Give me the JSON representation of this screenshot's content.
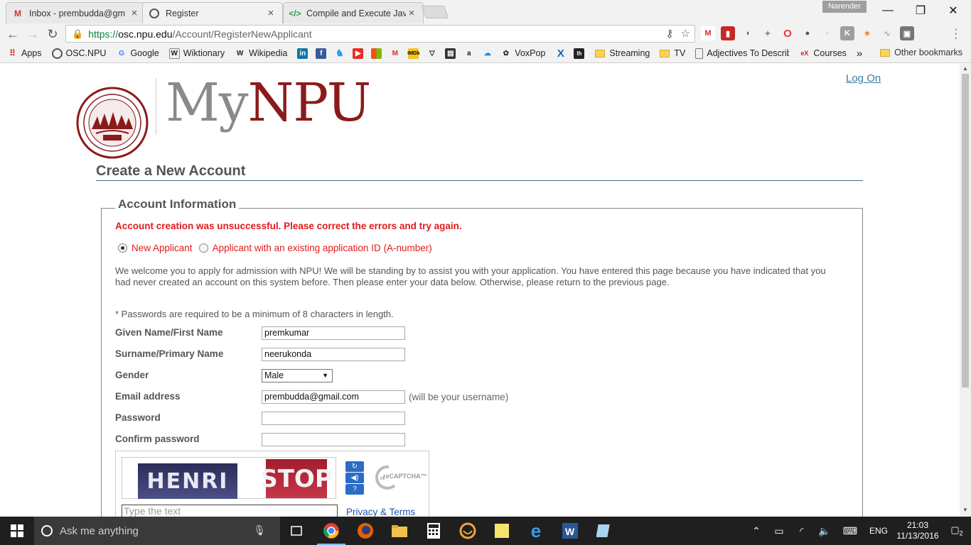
{
  "browser": {
    "tabs": [
      {
        "title": "Inbox - prembudda@gm",
        "icon": "gmail-icon"
      },
      {
        "title": "Register",
        "icon": "npu-icon"
      },
      {
        "title": "Compile and Execute Jav",
        "icon": "code-icon"
      }
    ],
    "profile_name": "Narender",
    "url": {
      "scheme": "https://",
      "host": "osc.npu.edu",
      "path": "/Account/RegisterNewApplicant"
    },
    "bookmarks": [
      "Apps",
      "OSC.NPU",
      "Google",
      "Wiktionary",
      "Wikipedia",
      "VoxPop",
      "Streaming",
      "TV",
      "Adjectives To Describe",
      "Courses"
    ],
    "bookmarks_overflow": "»",
    "other_bookmarks": "Other bookmarks"
  },
  "page": {
    "logo": {
      "my": "My",
      "npu": "NPU"
    },
    "login_link": "Log On",
    "title": "Create a New Account",
    "section_legend": "Account Information",
    "error_message": "Account creation was unsuccessful. Please correct the errors and try again.",
    "radio_new": "New Applicant",
    "radio_existing": "Applicant with an existing application ID (A-number)",
    "welcome_text": "We welcome you to apply for admission with NPU! We will be standing by to assist you with your application. You have entered this page because you have indicated that you had never created an account on this system before. Then please enter your data below. Otherwise, please return to the previous page.",
    "password_note": "* Passwords are required to be a minimum of 8 characters in length.",
    "fields": {
      "first_name_label": "Given Name/First Name",
      "first_name_value": "premkumar",
      "surname_label": "Surname/Primary Name",
      "surname_value": "neerukonda",
      "gender_label": "Gender",
      "gender_value": "Male",
      "email_label": "Email address",
      "email_value": "prembudda@gmail.com",
      "email_hint": "(will be your username)",
      "password_label": "Password",
      "confirm_label": "Confirm password"
    },
    "captcha": {
      "word1": "HENRI",
      "word2": "STOP",
      "placeholder": "Type the text",
      "privacy_link": "Privacy & Terms",
      "brand": "reCAPTCHA™"
    }
  },
  "taskbar": {
    "search_placeholder": "Ask me anything",
    "language": "ENG",
    "time": "21:03",
    "date": "11/13/2016",
    "notifications": "2"
  },
  "colors": {
    "brand_red": "#8b1a1a",
    "error_red": "#e01b1b",
    "link_blue": "#3a7ca5"
  }
}
